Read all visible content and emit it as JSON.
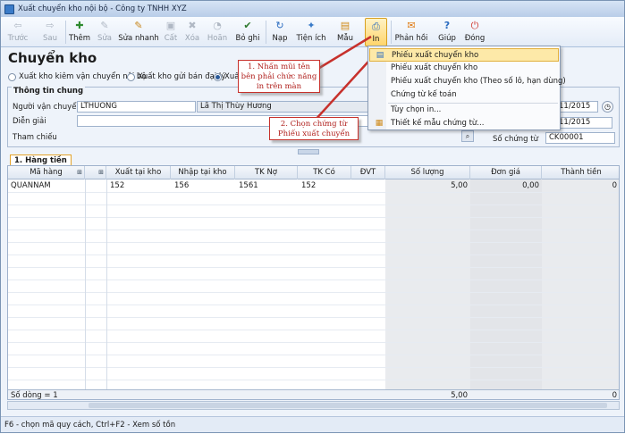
{
  "window": {
    "title": "Xuất chuyển kho nội bộ - Công ty TNHH XYZ"
  },
  "toolbar": {
    "buttons": [
      {
        "label": "Trước",
        "icon": "arrow-left-icon",
        "glyph": "⇦"
      },
      {
        "label": "Sau",
        "icon": "arrow-right-icon",
        "glyph": "⇨"
      },
      {
        "label": "Thêm",
        "icon": "add-doc-icon",
        "glyph": "✚"
      },
      {
        "label": "Sửa",
        "icon": "edit-icon",
        "glyph": "✎"
      },
      {
        "label": "Sửa nhanh",
        "icon": "quick-edit-icon",
        "glyph": "✎"
      },
      {
        "label": "Cất",
        "icon": "save-icon",
        "glyph": "▣"
      },
      {
        "label": "Xóa",
        "icon": "delete-icon",
        "glyph": "✖"
      },
      {
        "label": "Hoãn",
        "icon": "postpone-icon",
        "glyph": "◔"
      },
      {
        "label": "Bỏ ghi",
        "icon": "unpost-icon",
        "glyph": "✔"
      },
      {
        "label": "Nạp",
        "icon": "reload-icon",
        "glyph": "↻"
      },
      {
        "label": "Tiện ích",
        "icon": "utility-icon",
        "glyph": "✦"
      },
      {
        "label": "Mẫu",
        "icon": "template-icon",
        "glyph": "▤"
      },
      {
        "label": "In",
        "icon": "print-icon",
        "glyph": "⎙"
      },
      {
        "label": "Phản hồi",
        "icon": "feedback-icon",
        "glyph": "✉"
      },
      {
        "label": "Giúp",
        "icon": "help-icon",
        "glyph": "?"
      },
      {
        "label": "Đóng",
        "icon": "close-icon",
        "glyph": "⏻"
      }
    ]
  },
  "form": {
    "title": "Chuyển kho",
    "radios": [
      {
        "label": "Xuất kho kiêm vận chuyển nội bộ",
        "checked": false
      },
      {
        "label": "Xuất kho gửi bán đại lý",
        "checked": false
      },
      {
        "label": "Xuất",
        "checked": true
      }
    ],
    "group_title": "Thông tin chung",
    "fields": {
      "nguoi_van_chuyen_label": "Người vận chuyển",
      "nguoi_van_chuyen_code": "LTHUONG",
      "nguoi_van_chuyen_name": "Lã Thị Thùy Hương",
      "dien_giai_label": "Diễn giải",
      "tham_chieu_label": "Tham chiếu",
      "date1": "11/2015",
      "date2": "11/2015",
      "so_chung_tu_label": "Số chứng từ",
      "so_chung_tu": "CK00001"
    }
  },
  "tabs": [
    {
      "label": "1. Hàng tiền"
    }
  ],
  "grid": {
    "columns": [
      "Mã hàng",
      "Xuất tại kho",
      "Nhập tại kho",
      "TK Nợ",
      "TK Có",
      "ĐVT",
      "Số lượng",
      "Đơn giá",
      "Thành tiền"
    ],
    "rows": [
      {
        "ma_hang": "QUANNAM",
        "xuat_tai_kho": "152",
        "nhap_tai_kho": "156",
        "tk_no": "1561",
        "tk_co": "152",
        "dvt": "",
        "so_luong": "5,00",
        "don_gia": "0,00",
        "thanh_tien": "0"
      }
    ],
    "footer": {
      "row_count": "Số dòng = 1",
      "total_qty": "5,00",
      "total_amount": "0"
    }
  },
  "menu": {
    "items": [
      {
        "label": "Phiếu xuất chuyển kho",
        "selected": true,
        "icon": "doc-icon"
      },
      {
        "label": "Phiếu xuất chuyển kho",
        "selected": false,
        "icon": ""
      },
      {
        "label": "Phiếu xuất chuyển kho (Theo số lô, hạn dùng)",
        "selected": false,
        "icon": ""
      },
      {
        "label": "Chứng từ kế toán",
        "selected": false,
        "icon": ""
      },
      {
        "label": "Tùy chọn in...",
        "selected": false,
        "icon": ""
      },
      {
        "label": "Thiết kế mẫu chứng từ...",
        "selected": false,
        "icon": "design-icon"
      }
    ]
  },
  "callouts": {
    "c1": "1. Nhấn mũi tên bên phải chức năng in trên màn",
    "c2": "2. Chọn chứng từ Phiếu xuất chuyển"
  },
  "statusbar": {
    "text": "F6 - chọn mã quy cách, Ctrl+F2 - Xem số tồn"
  },
  "colors": {
    "callout_red": "#c7312c",
    "menu_highlight": "#fde9a8",
    "title_blue": "#b9cde8"
  }
}
